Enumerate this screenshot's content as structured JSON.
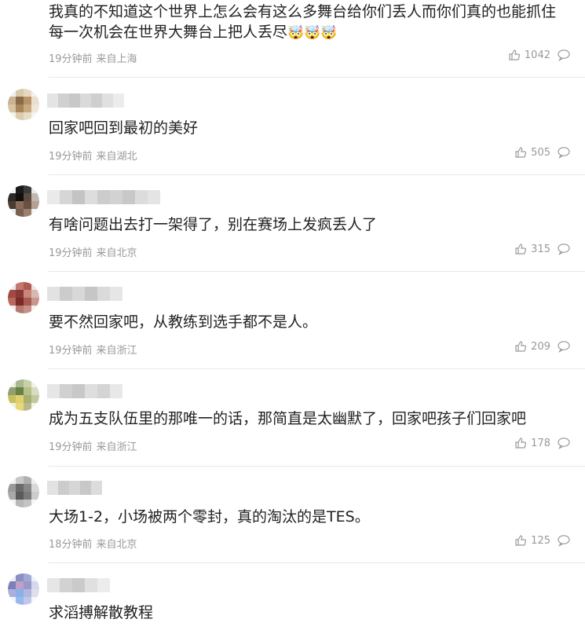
{
  "comments": [
    {
      "text": "我真的不知道这个世界上怎么会有这么多舞台给你们丢人而你们真的也能抓住每一次机会在世界大舞台上把人丢尽",
      "emoji": "🤯🤯🤯",
      "time": "19分钟前",
      "location": "来自上海",
      "likes": "1042"
    },
    {
      "text": "回家吧回到最初的美好",
      "time": "19分钟前",
      "location": "来自湖北",
      "likes": "505"
    },
    {
      "text": "有啥问题出去打一架得了，别在赛场上发疯丢人了",
      "time": "19分钟前",
      "location": "来自北京",
      "likes": "315"
    },
    {
      "text": "要不然回家吧，从教练到选手都不是人。",
      "time": "19分钟前",
      "location": "来自浙江",
      "likes": "209"
    },
    {
      "text": "成为五支队伍里的那唯一的话，那简直是太幽默了，回家吧孩子们回家吧",
      "time": "19分钟前",
      "location": "来自浙江",
      "likes": "178"
    },
    {
      "text": "大场1-2，小场被两个零封，真的淘汰的是TES。",
      "time": "18分钟前",
      "location": "来自北京",
      "likes": "125"
    },
    {
      "text": "求滔搏解散教程"
    }
  ],
  "colors": {
    "meta": "#999999",
    "text": "#222222",
    "divider": "#e8e8e8"
  },
  "icons": {
    "like": "thumbs-up-icon",
    "reply": "comment-bubble-icon"
  }
}
